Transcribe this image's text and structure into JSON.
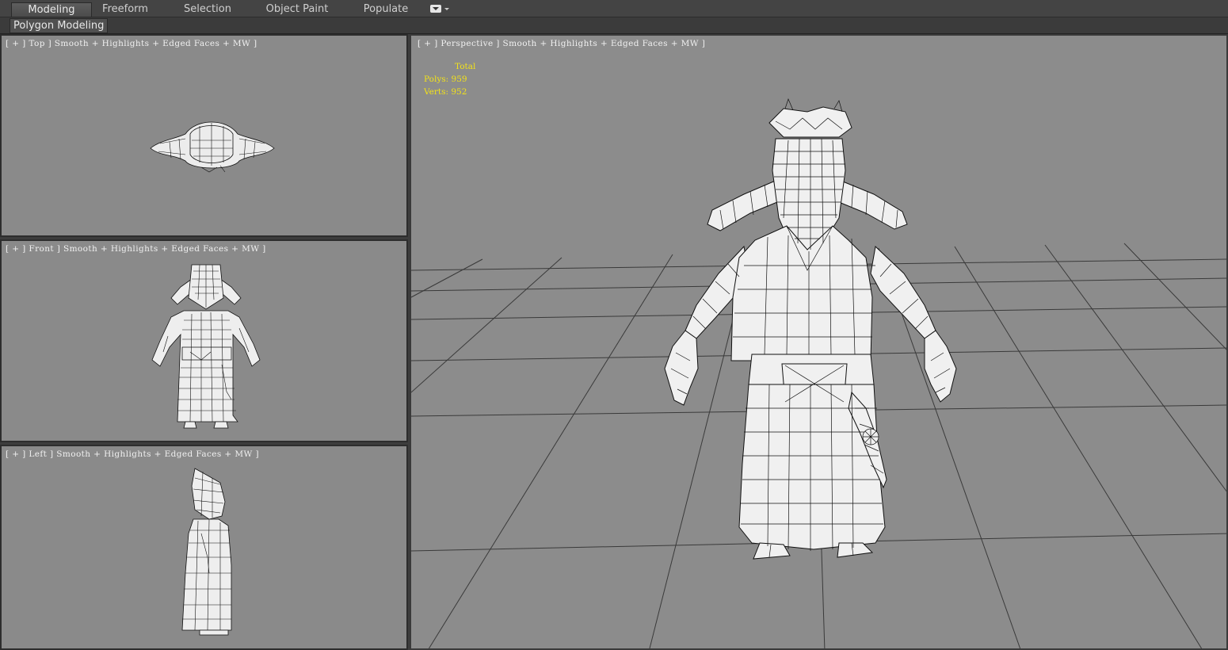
{
  "ribbon": {
    "tabs": [
      "Modeling",
      "Freeform",
      "Selection",
      "Object Paint",
      "Populate"
    ],
    "active_tab": "Modeling",
    "panel_label": "Polygon Modeling"
  },
  "viewports": {
    "top": "[ + ] Top ] Smooth + Highlights + Edged Faces + MW ]",
    "front": "[ + ] Front ] Smooth + Highlights + Edged Faces + MW ]",
    "left": "[ + ] Left ] Smooth + Highlights + Edged Faces + MW ]",
    "perspective": "[ + ] Perspective ] Smooth + Highlights + Edged Faces + MW ]"
  },
  "stats": {
    "header": "Total",
    "polys": "Polys: 959",
    "verts": "Verts: 952"
  },
  "colors": {
    "viewport_bg": "#8a8a8a",
    "stats_text": "#f2e21a",
    "ui_bg": "#3d3d3d"
  }
}
